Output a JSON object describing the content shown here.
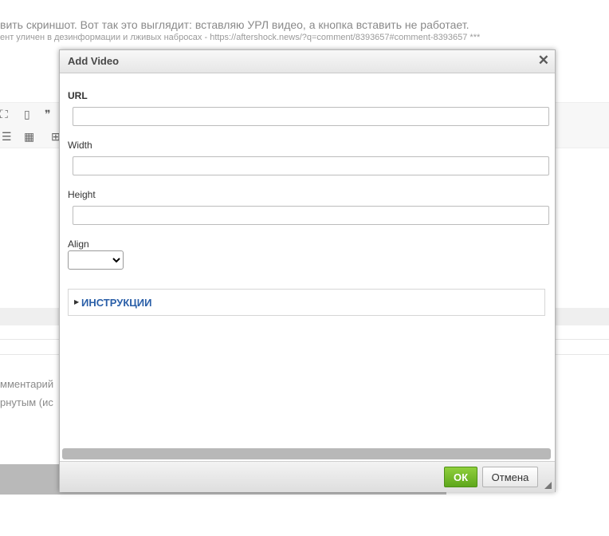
{
  "background": {
    "line1": "вить скриншот. Вот так это выглядит: вставляю УРЛ видео, а кнопка вставить не работает.",
    "line2": "ент уличен в дезинформации и лживых набросах - https://aftershock.news/?q=comment/8393657#comment-8393657 ***",
    "line3": "мментарий",
    "line4": "рнутым (ис",
    "toolbar_icons": [
      "maximize-icon",
      "show-blocks-icon",
      "blockquote-icon",
      "bulleted-list-icon",
      "table-icon",
      "horizontal-rule-icon"
    ],
    "toolbar_glyphs": {
      "maximize": "⛶",
      "show_blocks": "▯",
      "blockquote": "❞",
      "bulleted_list": "☰",
      "table": "▦",
      "horizontal_rule": "⊞"
    }
  },
  "dialog": {
    "title": "Add Video",
    "close_glyph": "✕",
    "fields": {
      "url_label": "URL",
      "url_value": "",
      "width_label": "Width",
      "width_value": "",
      "height_label": "Height",
      "height_value": "",
      "align_label": "Align",
      "align_value": ""
    },
    "instructions_label": "ИНСТРУКЦИИ",
    "instructions_arrow": "▶",
    "ok_label": "ОК",
    "cancel_label": "Отмена"
  },
  "colors": {
    "ok_button": "#6cb32a",
    "link_blue": "#2a5fa8",
    "header_bg": "#ececec"
  }
}
